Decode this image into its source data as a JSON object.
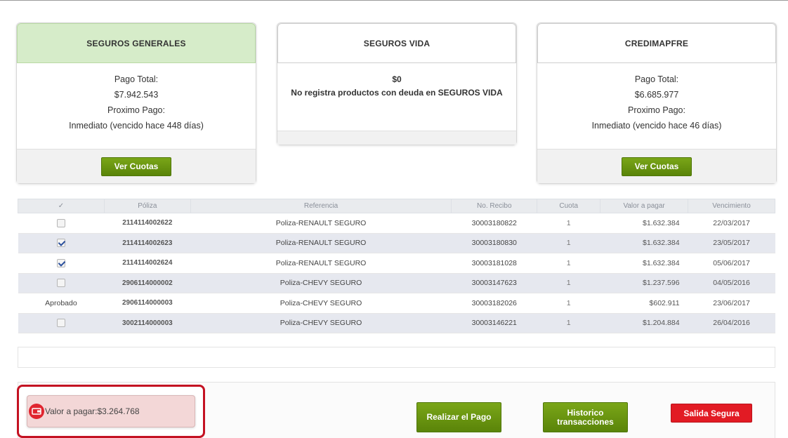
{
  "cards": [
    {
      "title": "SEGUROS GENERALES",
      "lines": [
        "Pago Total:",
        "$7.942.543",
        "Proximo Pago:",
        "Inmediato (vencido hace 448 días)"
      ],
      "button": "Ver Cuotas"
    },
    {
      "title": "SEGUROS VIDA",
      "lines": [
        "$0",
        "No registra productos con deuda en SEGUROS VIDA"
      ]
    },
    {
      "title": "CREDIMAPFRE",
      "lines": [
        "Pago Total:",
        "$6.685.977",
        "Proximo Pago:",
        "Inmediato (vencido hace 46 días)"
      ],
      "button": "Ver Cuotas"
    }
  ],
  "table": {
    "headers": [
      "✓",
      "Póliza",
      "Referencia",
      "No. Recibo",
      "Cuota",
      "Valor a pagar",
      "Vencimiento"
    ],
    "rows": [
      {
        "status": "unchecked",
        "poliza": "2114114002622",
        "referencia": "Poliza-RENAULT SEGURO",
        "recibo": "30003180822",
        "cuota": "1",
        "valor": "$1.632.384",
        "vencimiento": "22/03/2017"
      },
      {
        "status": "checked",
        "poliza": "2114114002623",
        "referencia": "Poliza-RENAULT SEGURO",
        "recibo": "30003180830",
        "cuota": "1",
        "valor": "$1.632.384",
        "vencimiento": "23/05/2017"
      },
      {
        "status": "checked",
        "poliza": "2114114002624",
        "referencia": "Poliza-RENAULT SEGURO",
        "recibo": "30003181028",
        "cuota": "1",
        "valor": "$1.632.384",
        "vencimiento": "05/06/2017"
      },
      {
        "status": "unchecked",
        "poliza": "2906114000002",
        "referencia": "Poliza-CHEVY SEGURO",
        "recibo": "30003147623",
        "cuota": "1",
        "valor": "$1.237.596",
        "vencimiento": "04/05/2016"
      },
      {
        "status": "Aprobado",
        "poliza": "2906114000003",
        "referencia": "Poliza-CHEVY SEGURO",
        "recibo": "30003182026",
        "cuota": "1",
        "valor": "$602.911",
        "vencimiento": "23/06/2017"
      },
      {
        "status": "unchecked",
        "poliza": "3002114000003",
        "referencia": "Poliza-CHEVY SEGURO",
        "recibo": "30003146221",
        "cuota": "1",
        "valor": "$1.204.884",
        "vencimiento": "26/04/2016"
      }
    ]
  },
  "footer": {
    "valor_label": "Valor a pagar:$3.264.768",
    "realizar_pago": "Realizar el Pago",
    "historico": "Historico transacciones",
    "salida": "Salida Segura"
  },
  "icons": {
    "wallet": "wallet-icon"
  },
  "colors": {
    "green_button": "#6b9612",
    "red_button": "#e21b24",
    "active_header": "#d6ecc9",
    "highlight_border": "#c41222"
  }
}
